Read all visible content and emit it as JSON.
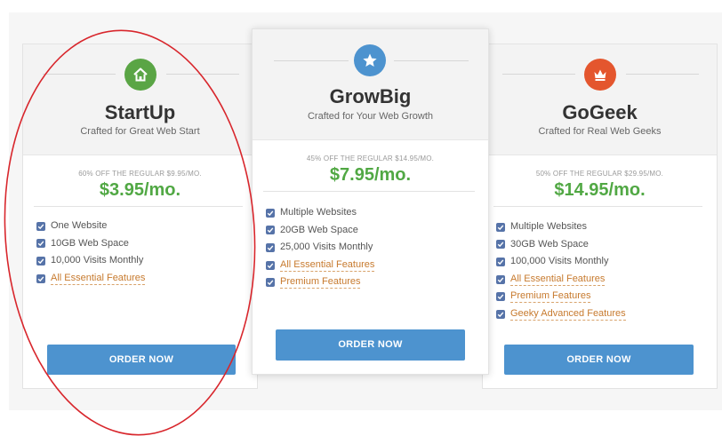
{
  "plans": [
    {
      "name": "StartUp",
      "tagline": "Crafted for Great Web Start",
      "regular_price": "60% OFF THE REGULAR $9.95/MO.",
      "price": "$3.95/mo.",
      "icon": "home-icon",
      "icon_color": "#5aa545",
      "features": [
        {
          "label": "One Website",
          "link": false
        },
        {
          "label": "10GB Web Space",
          "link": false
        },
        {
          "label": "10,000 Visits Monthly",
          "link": false
        },
        {
          "label": "All Essential Features",
          "link": true
        }
      ],
      "button": "ORDER NOW"
    },
    {
      "name": "GrowBig",
      "tagline": "Crafted for Your Web Growth",
      "regular_price": "45% OFF THE REGULAR $14.95/MO.",
      "price": "$7.95/mo.",
      "icon": "star-icon",
      "icon_color": "#4d93cf",
      "features": [
        {
          "label": "Multiple Websites",
          "link": false
        },
        {
          "label": "20GB Web Space",
          "link": false
        },
        {
          "label": "25,000 Visits Monthly",
          "link": false
        },
        {
          "label": "All Essential Features",
          "link": true
        },
        {
          "label": "Premium Features",
          "link": true
        }
      ],
      "button": "ORDER NOW"
    },
    {
      "name": "GoGeek",
      "tagline": "Crafted for Real Web Geeks",
      "regular_price": "50% OFF THE REGULAR $29.95/MO.",
      "price": "$14.95/mo.",
      "icon": "crown-icon",
      "icon_color": "#e4562e",
      "features": [
        {
          "label": "Multiple Websites",
          "link": false
        },
        {
          "label": "30GB Web Space",
          "link": false
        },
        {
          "label": "100,000 Visits Monthly",
          "link": false
        },
        {
          "label": "All Essential Features",
          "link": true
        },
        {
          "label": "Premium Features",
          "link": true
        },
        {
          "label": "Geeky Advanced Features",
          "link": true
        }
      ],
      "button": "ORDER NOW"
    }
  ],
  "colors": {
    "price_green": "#51a844",
    "button_blue": "#4d93cf",
    "checkbox_blue": "#5673a8",
    "link_orange": "#c77a2e",
    "annotation_red": "#d8262c"
  }
}
